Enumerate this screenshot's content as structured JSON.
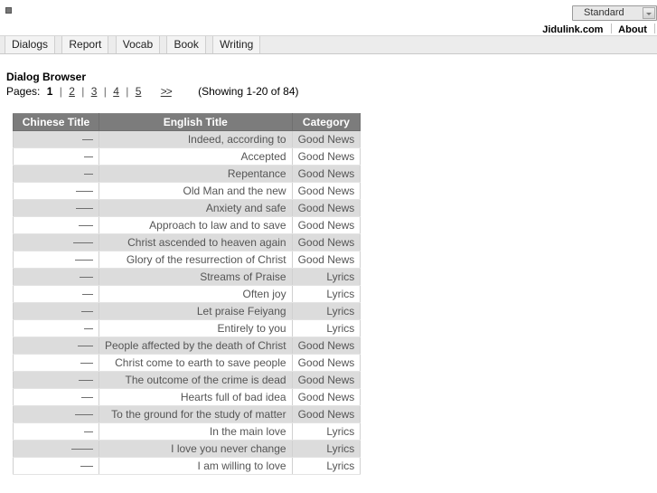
{
  "window": {
    "title": "Dialog Browser"
  },
  "topbar": {
    "broken_image_icon": "broken-image-icon",
    "style_select": {
      "selected": "Standard",
      "options": [
        "Standard"
      ],
      "arrow_icon": "chevron-down-icon"
    },
    "links": [
      {
        "label": "Jidulink.com"
      },
      {
        "label": "About"
      }
    ]
  },
  "tabs": [
    {
      "label": "Dialogs"
    },
    {
      "label": "Report"
    },
    {
      "label": "Vocab"
    },
    {
      "label": "Book"
    },
    {
      "label": "Writing"
    }
  ],
  "page": {
    "heading": "Dialog Browser",
    "pager": {
      "label": "Pages:",
      "current": "1",
      "separator": "|",
      "links": [
        "2",
        "3",
        "4",
        "5"
      ],
      "next": ">>",
      "showing": "(Showing 1-20 of 84)"
    }
  },
  "table": {
    "columns": [
      "Chinese Title",
      "English Title",
      "Category"
    ],
    "rows": [
      {
        "chinese": "—",
        "chinese_width": 12,
        "english": "Indeed, according to",
        "category": "Good News"
      },
      {
        "chinese": "—",
        "chinese_width": 10,
        "english": "Accepted",
        "category": "Good News"
      },
      {
        "chinese": "—",
        "chinese_width": 10,
        "english": "Repentance",
        "category": "Good News"
      },
      {
        "chinese": "—",
        "chinese_width": 19,
        "english": "Old Man and the new",
        "category": "Good News"
      },
      {
        "chinese": "—",
        "chinese_width": 19,
        "english": "Anxiety and safe",
        "category": "Good News"
      },
      {
        "chinese": "—",
        "chinese_width": 16,
        "english": "Approach to law and to save",
        "category": "Good News"
      },
      {
        "chinese": "—",
        "chinese_width": 22,
        "english": "Christ ascended to heaven again",
        "category": "Good News"
      },
      {
        "chinese": "—",
        "chinese_width": 20,
        "english": "Glory of the resurrection of Christ",
        "category": "Good News"
      },
      {
        "chinese": "—",
        "chinese_width": 15,
        "english": "Streams of Praise",
        "category": "Lyrics"
      },
      {
        "chinese": "—",
        "chinese_width": 12,
        "english": "Often joy",
        "category": "Lyrics"
      },
      {
        "chinese": "—",
        "chinese_width": 13,
        "english": "Let praise Feiyang",
        "category": "Lyrics"
      },
      {
        "chinese": "—",
        "chinese_width": 10,
        "english": "Entirely to you",
        "category": "Lyrics"
      },
      {
        "chinese": "—",
        "chinese_width": 17,
        "english": "People affected by the death of Christ",
        "category": "Good News"
      },
      {
        "chinese": "—",
        "chinese_width": 14,
        "english": "Christ come to earth to save people",
        "category": "Good News"
      },
      {
        "chinese": "—",
        "chinese_width": 16,
        "english": "The outcome of the crime is dead",
        "category": "Good News"
      },
      {
        "chinese": "—",
        "chinese_width": 13,
        "english": "Hearts full of bad idea",
        "category": "Good News"
      },
      {
        "chinese": "—",
        "chinese_width": 20,
        "english": "To the ground for the study of matter",
        "category": "Good News"
      },
      {
        "chinese": "—",
        "chinese_width": 10,
        "english": "In the main love",
        "category": "Lyrics"
      },
      {
        "chinese": "—",
        "chinese_width": 24,
        "english": "I love you never change",
        "category": "Lyrics"
      },
      {
        "chinese": "—",
        "chinese_width": 14,
        "english": "I am willing to love",
        "category": "Lyrics"
      }
    ]
  },
  "colors": {
    "header_bg": "#7c7c7c",
    "header_text": "#ffffff",
    "row_odd": "#dcdcdc",
    "row_even": "#ffffff",
    "cell_text": "#555555",
    "tab_bar_bg": "#ececec"
  }
}
